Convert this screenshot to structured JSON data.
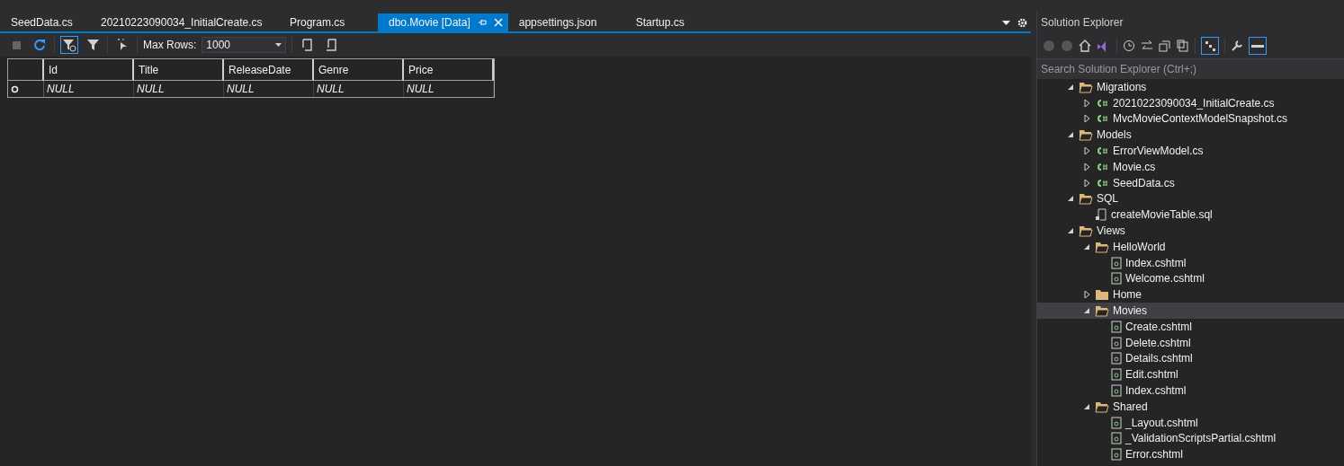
{
  "tabs": [
    {
      "label": "SeedData.cs",
      "selected": false
    },
    {
      "label": "20210223090034_InitialCreate.cs",
      "selected": false
    },
    {
      "label": "Program.cs",
      "selected": false
    },
    {
      "label": "dbo.Movie [Data]",
      "selected": true
    },
    {
      "label": "appsettings.json",
      "selected": false
    },
    {
      "label": "Startup.cs",
      "selected": false
    }
  ],
  "data_toolbar": {
    "max_rows_label": "Max Rows:",
    "max_rows_value": "1000"
  },
  "grid": {
    "columns": [
      "Id",
      "Title",
      "ReleaseDate",
      "Genre",
      "Price"
    ],
    "rows": [
      [
        "NULL",
        "NULL",
        "NULL",
        "NULL",
        "NULL"
      ]
    ]
  },
  "solution_explorer": {
    "title": "Solution Explorer",
    "search": {
      "placeholder": "Search Solution Explorer (Ctrl+;)"
    },
    "tree": [
      {
        "label": "Migrations",
        "kind": "folder",
        "expanded": true,
        "selected": false,
        "children": [
          {
            "label": "20210223090034_InitialCreate.cs",
            "kind": "csharp",
            "expanded": false,
            "selected": false
          },
          {
            "label": "MvcMovieContextModelSnapshot.cs",
            "kind": "csharp",
            "expanded": false,
            "selected": false
          }
        ]
      },
      {
        "label": "Models",
        "kind": "folder",
        "expanded": true,
        "selected": false,
        "children": [
          {
            "label": "ErrorViewModel.cs",
            "kind": "csharp",
            "expanded": false,
            "selected": false
          },
          {
            "label": "Movie.cs",
            "kind": "csharp",
            "expanded": false,
            "selected": false
          },
          {
            "label": "SeedData.cs",
            "kind": "csharp",
            "expanded": false,
            "selected": false
          }
        ]
      },
      {
        "label": "SQL",
        "kind": "folder",
        "expanded": true,
        "selected": false,
        "children": [
          {
            "label": "createMovieTable.sql",
            "kind": "sql",
            "selected": false
          }
        ]
      },
      {
        "label": "Views",
        "kind": "folder",
        "expanded": true,
        "selected": false,
        "children": [
          {
            "label": "HelloWorld",
            "kind": "folder",
            "expanded": true,
            "selected": false,
            "children": [
              {
                "label": "Index.cshtml",
                "kind": "cshtml",
                "selected": false
              },
              {
                "label": "Welcome.cshtml",
                "kind": "cshtml",
                "selected": false
              }
            ]
          },
          {
            "label": "Home",
            "kind": "folder",
            "expanded": false,
            "selected": false
          },
          {
            "label": "Movies",
            "kind": "folder",
            "expanded": true,
            "selected": true,
            "children": [
              {
                "label": "Create.cshtml",
                "kind": "cshtml",
                "selected": false
              },
              {
                "label": "Delete.cshtml",
                "kind": "cshtml",
                "selected": false
              },
              {
                "label": "Details.cshtml",
                "kind": "cshtml",
                "selected": false
              },
              {
                "label": "Edit.cshtml",
                "kind": "cshtml",
                "selected": false
              },
              {
                "label": "Index.cshtml",
                "kind": "cshtml",
                "selected": false
              }
            ]
          },
          {
            "label": "Shared",
            "kind": "folder",
            "expanded": true,
            "selected": false,
            "children": [
              {
                "label": "_Layout.cshtml",
                "kind": "cshtml",
                "selected": false
              },
              {
                "label": "_ValidationScriptsPartial.cshtml",
                "kind": "cshtml",
                "selected": false
              },
              {
                "label": "Error.cshtml",
                "kind": "cshtml",
                "selected": false
              }
            ]
          }
        ]
      }
    ]
  }
}
